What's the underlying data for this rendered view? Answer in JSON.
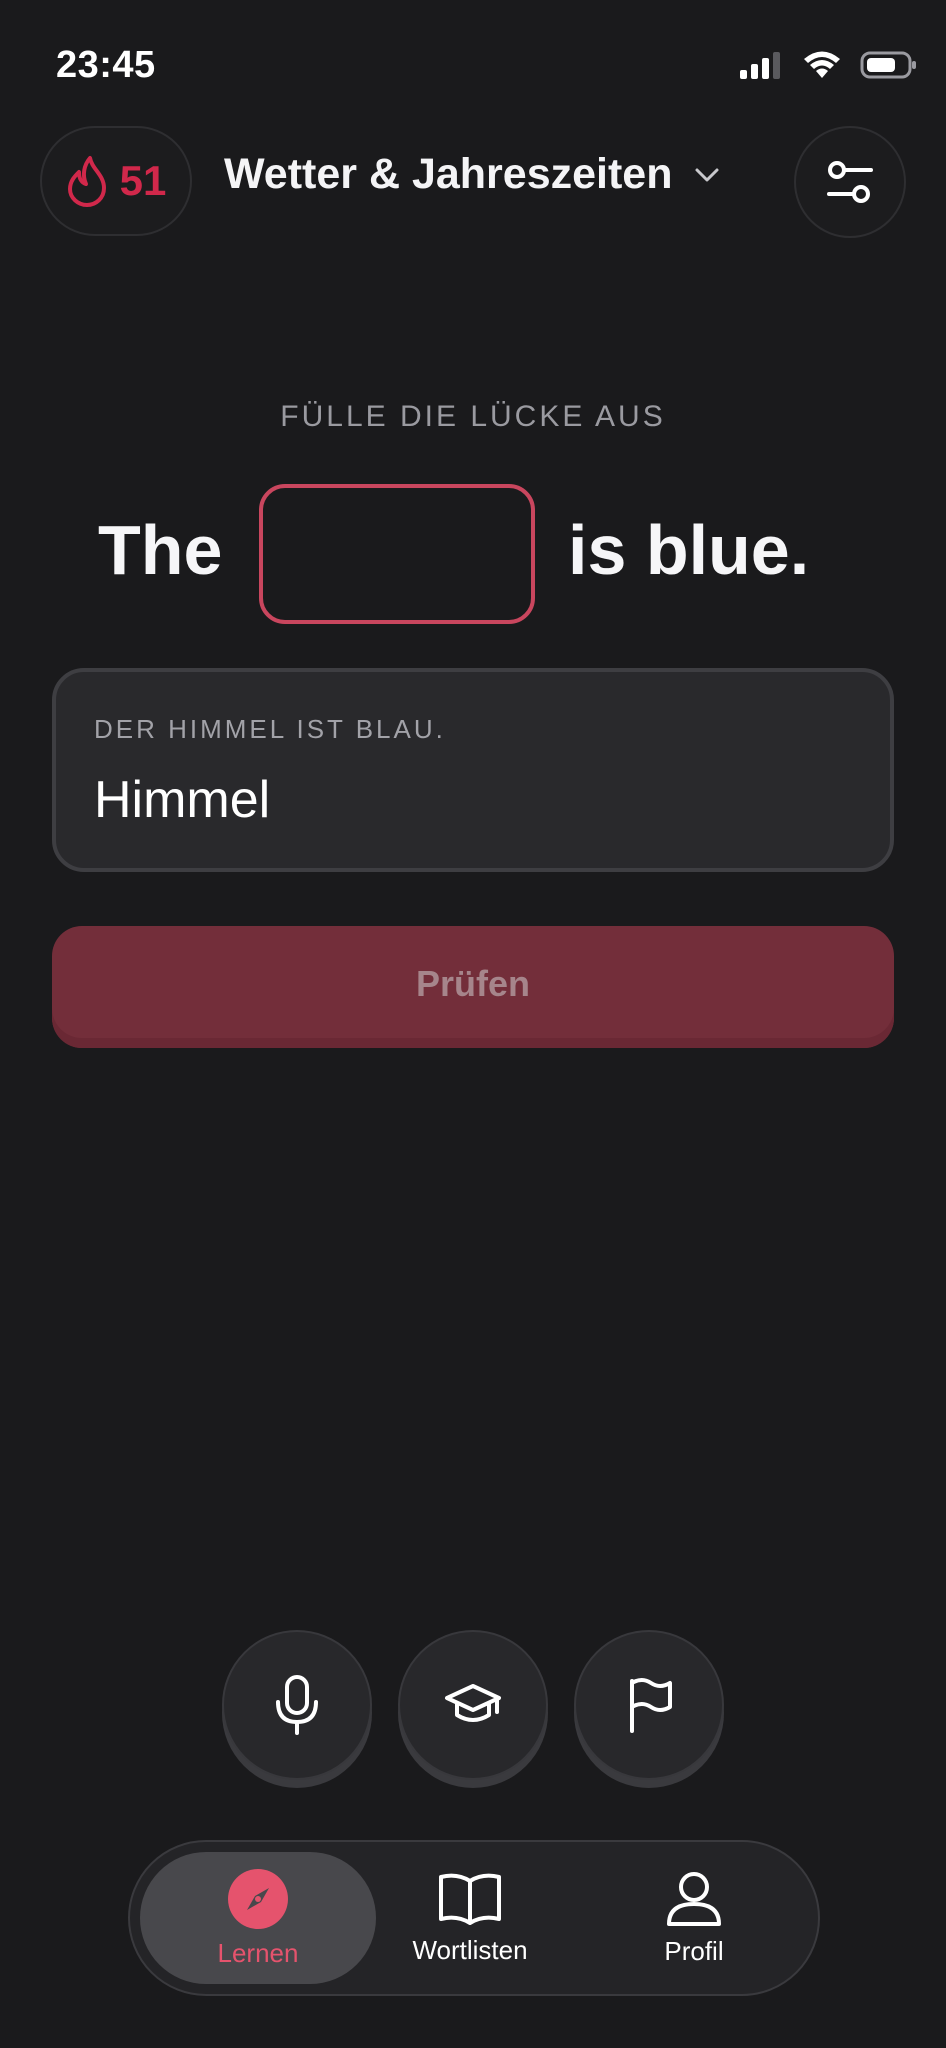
{
  "status_bar": {
    "time": "23:45"
  },
  "header": {
    "streak_count": "51",
    "topic": "Wetter & Jahreszeiten"
  },
  "exercise": {
    "instruction": "FÜLLE DIE LÜCKE AUS",
    "sentence_before": "The",
    "sentence_after": "is blue.",
    "hint": "DER HIMMEL IST BLAU.",
    "answer_value": "Himmel",
    "check_label": "Prüfen"
  },
  "tools": [
    {
      "icon": "microphone-icon"
    },
    {
      "icon": "graduation-cap-icon"
    },
    {
      "icon": "flag-icon"
    }
  ],
  "nav": {
    "items": [
      {
        "label": "Lernen",
        "icon": "compass-icon",
        "active": true
      },
      {
        "label": "Wortlisten",
        "icon": "book-icon",
        "active": false
      },
      {
        "label": "Profil",
        "icon": "person-icon",
        "active": false
      }
    ]
  },
  "colors": {
    "background": "#1a1a1c",
    "accent": "#e5536d",
    "streak": "#d1284b",
    "button_disabled": "#732e3a"
  }
}
